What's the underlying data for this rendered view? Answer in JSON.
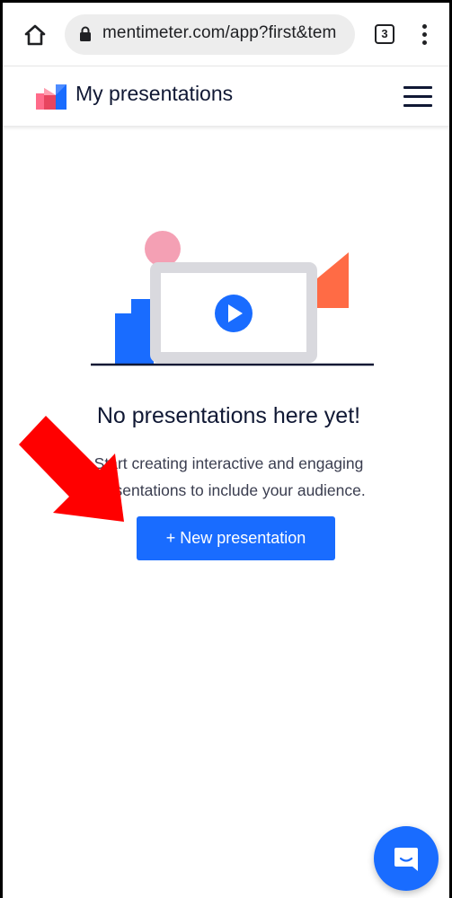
{
  "browser": {
    "url": "mentimeter.com/app?first&tem",
    "tab_count": "3"
  },
  "header": {
    "title": "My presentations"
  },
  "empty_state": {
    "title": "No presentations here yet!",
    "description_line1": "Start creating interactive and engaging",
    "description_line2": "presentations to include your audience.",
    "button_label": "+ New presentation"
  },
  "colors": {
    "accent": "#196cff",
    "arrow_annotation": "#ff0000",
    "illustration_circle": "#f4a0b4",
    "illustration_triangle": "#ff6b45"
  },
  "icons": {
    "home": "home-icon",
    "lock": "lock-icon",
    "menu": "hamburger-menu-icon",
    "chat": "chat-icon",
    "play": "play-icon"
  }
}
